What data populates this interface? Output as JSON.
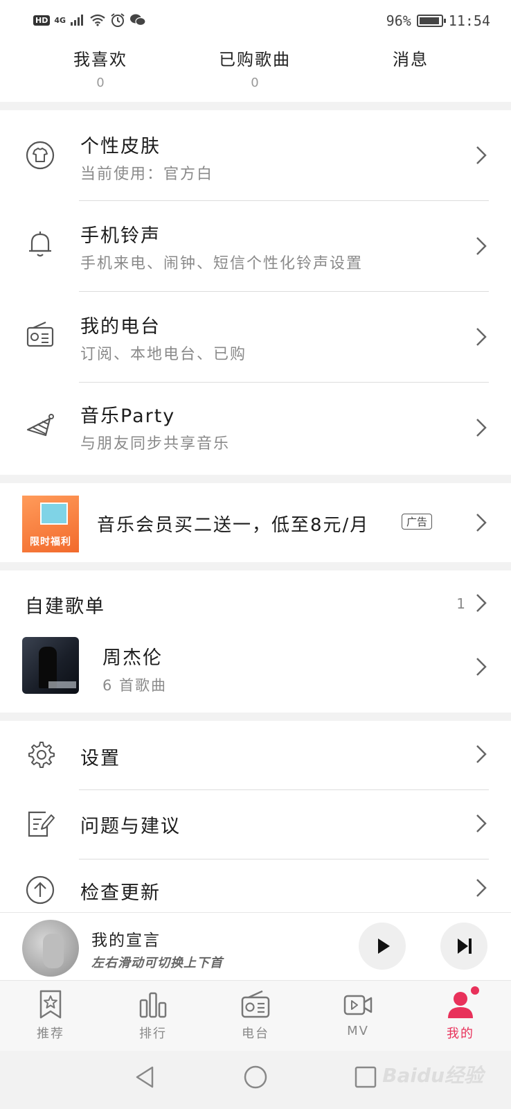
{
  "status_bar": {
    "hd": "HD",
    "network": "4G",
    "battery": "96%",
    "time": "11:54"
  },
  "stats": [
    {
      "label": "我喜欢",
      "count": "0"
    },
    {
      "label": "已购歌曲",
      "count": "0"
    },
    {
      "label": "消息",
      "count": ""
    }
  ],
  "menu": {
    "skin": {
      "title": "个性皮肤",
      "sub": "当前使用：官方白"
    },
    "ringtone": {
      "title": "手机铃声",
      "sub": "手机来电、闹钟、短信个性化铃声设置"
    },
    "radio": {
      "title": "我的电台",
      "sub": "订阅、本地电台、已购"
    },
    "party": {
      "title": "音乐Party",
      "sub": "与朋友同步共享音乐"
    }
  },
  "promo": {
    "image_text": "限时福利",
    "text": "音乐会员买二送一，低至8元/月",
    "ad_tag": "广告"
  },
  "playlists": {
    "header": "自建歌单",
    "count": "1",
    "items": [
      {
        "title": "周杰伦",
        "sub": "6 首歌曲"
      }
    ]
  },
  "settings": {
    "settings": "设置",
    "feedback": "问题与建议",
    "update": "检查更新"
  },
  "player": {
    "title": "我的宣言",
    "sub": "左右滑动可切换上下首"
  },
  "tabs": [
    {
      "label": "推荐",
      "icon": "bookmark-star-icon"
    },
    {
      "label": "排行",
      "icon": "bar-chart-icon"
    },
    {
      "label": "电台",
      "icon": "radio-icon"
    },
    {
      "label": "MV",
      "icon": "video-icon"
    },
    {
      "label": "我的",
      "icon": "user-icon"
    }
  ],
  "watermark": "Baidu经验",
  "colors": {
    "accent": "#e8315a",
    "text": "#1c1c1c",
    "secondary": "#8a8a8a"
  }
}
